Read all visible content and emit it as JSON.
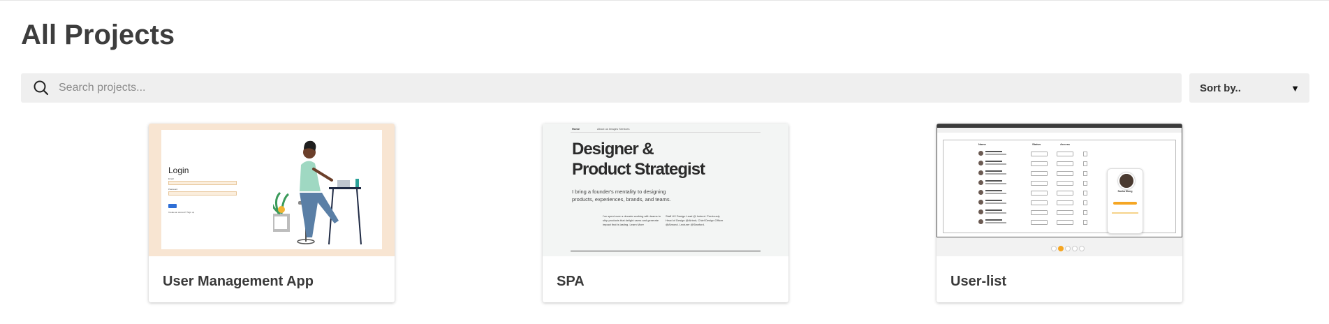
{
  "page": {
    "title": "All Projects"
  },
  "search": {
    "placeholder": "Search projects..."
  },
  "sort": {
    "label": "Sort by..",
    "chevron": "▼"
  },
  "projects": [
    {
      "title": "User Management App",
      "thumbnail": {
        "heading": "Login",
        "email_label": "Email",
        "password_label": "Password",
        "footer": "Create an account? Sign up",
        "background": "#f8e5d2"
      }
    },
    {
      "title": "SPA",
      "thumbnail": {
        "brand": "Home",
        "nav": "About us    Images    Services",
        "hero_line1": "Designer &",
        "hero_line2": "Product Strategist",
        "sub_line1": "I bring a founder's mentality to designing",
        "sub_line2": "products, experiences, brands, and teams.",
        "col1": "I've spent over a decade working with teams to ship products that delight users and generate impact that is lasting. Learn More",
        "col2": "Staff UX Design Lead @ Indeed. Previously Head of Design @Airbnb, Chief Design Officer @Almond. Lecturer @Stanford.",
        "background": "#f3f5f4"
      }
    },
    {
      "title": "User-list",
      "thumbnail": {
        "col_name": "Name",
        "col_status": "Status",
        "col_access": "Access",
        "profile_name": "Sasha Wong",
        "accent": "#f5a623"
      }
    }
  ]
}
